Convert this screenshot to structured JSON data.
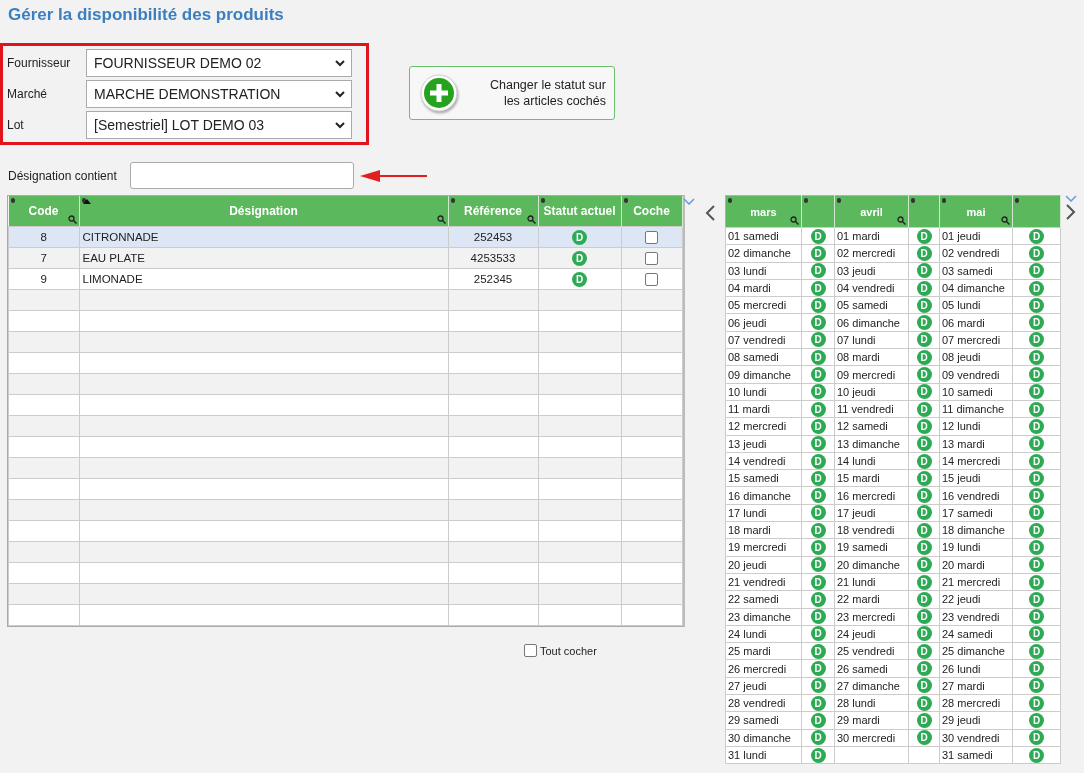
{
  "title": "Gérer la disponibilité des produits",
  "filters": [
    {
      "label": "Fournisseur",
      "value": "FOURNISSEUR DEMO 02"
    },
    {
      "label": "Marché",
      "value": "MARCHE DEMONSTRATION"
    },
    {
      "label": "Lot",
      "value": "[Semestriel] LOT DEMO 03"
    }
  ],
  "action_button": {
    "label": "Changer le statut sur les articles cochés"
  },
  "search": {
    "label": "Désignation contient"
  },
  "products": {
    "columns": [
      {
        "label": "Code",
        "filter": true,
        "sorted": false
      },
      {
        "label": "Désignation",
        "filter": true,
        "sorted": true
      },
      {
        "label": "Référence",
        "filter": true,
        "sorted": false
      },
      {
        "label": "Statut actuel",
        "filter": false,
        "sorted": false
      },
      {
        "label": "Coche",
        "filter": false,
        "sorted": false
      }
    ],
    "rows": [
      {
        "code": "8",
        "designation": "CITRONNADE",
        "reference": "252453",
        "status": "D",
        "checked": false,
        "selected": true
      },
      {
        "code": "7",
        "designation": "EAU PLATE",
        "reference": "4253533",
        "status": "D",
        "checked": false,
        "selected": false
      },
      {
        "code": "9",
        "designation": "LIMONADE",
        "reference": "252345",
        "status": "D",
        "checked": false,
        "selected": false
      }
    ]
  },
  "select_all": {
    "label": "Tout cocher",
    "checked": false
  },
  "calendar": {
    "months": [
      {
        "name": "mars",
        "days": [
          {
            "label": "01 samedi",
            "status": "D"
          },
          {
            "label": "02 dimanche",
            "status": "D"
          },
          {
            "label": "03 lundi",
            "status": "D"
          },
          {
            "label": "04 mardi",
            "status": "D"
          },
          {
            "label": "05 mercredi",
            "status": "D"
          },
          {
            "label": "06 jeudi",
            "status": "D"
          },
          {
            "label": "07 vendredi",
            "status": "D"
          },
          {
            "label": "08 samedi",
            "status": "D"
          },
          {
            "label": "09 dimanche",
            "status": "D"
          },
          {
            "label": "10 lundi",
            "status": "D"
          },
          {
            "label": "11 mardi",
            "status": "D"
          },
          {
            "label": "12 mercredi",
            "status": "D"
          },
          {
            "label": "13 jeudi",
            "status": "D"
          },
          {
            "label": "14 vendredi",
            "status": "D"
          },
          {
            "label": "15 samedi",
            "status": "D"
          },
          {
            "label": "16 dimanche",
            "status": "D"
          },
          {
            "label": "17 lundi",
            "status": "D"
          },
          {
            "label": "18 mardi",
            "status": "D"
          },
          {
            "label": "19 mercredi",
            "status": "D"
          },
          {
            "label": "20 jeudi",
            "status": "D"
          },
          {
            "label": "21 vendredi",
            "status": "D"
          },
          {
            "label": "22 samedi",
            "status": "D"
          },
          {
            "label": "23 dimanche",
            "status": "D"
          },
          {
            "label": "24 lundi",
            "status": "D"
          },
          {
            "label": "25 mardi",
            "status": "D"
          },
          {
            "label": "26 mercredi",
            "status": "D"
          },
          {
            "label": "27 jeudi",
            "status": "D"
          },
          {
            "label": "28 vendredi",
            "status": "D"
          },
          {
            "label": "29 samedi",
            "status": "D"
          },
          {
            "label": "30 dimanche",
            "status": "D"
          },
          {
            "label": "31 lundi",
            "status": "D"
          }
        ]
      },
      {
        "name": "avril",
        "days": [
          {
            "label": "01 mardi",
            "status": "D"
          },
          {
            "label": "02 mercredi",
            "status": "D"
          },
          {
            "label": "03 jeudi",
            "status": "D"
          },
          {
            "label": "04 vendredi",
            "status": "D"
          },
          {
            "label": "05 samedi",
            "status": "D"
          },
          {
            "label": "06 dimanche",
            "status": "D"
          },
          {
            "label": "07 lundi",
            "status": "D"
          },
          {
            "label": "08 mardi",
            "status": "D"
          },
          {
            "label": "09 mercredi",
            "status": "D"
          },
          {
            "label": "10 jeudi",
            "status": "D"
          },
          {
            "label": "11 vendredi",
            "status": "D"
          },
          {
            "label": "12 samedi",
            "status": "D"
          },
          {
            "label": "13 dimanche",
            "status": "D"
          },
          {
            "label": "14 lundi",
            "status": "D"
          },
          {
            "label": "15 mardi",
            "status": "D"
          },
          {
            "label": "16 mercredi",
            "status": "D"
          },
          {
            "label": "17 jeudi",
            "status": "D"
          },
          {
            "label": "18 vendredi",
            "status": "D"
          },
          {
            "label": "19 samedi",
            "status": "D"
          },
          {
            "label": "20 dimanche",
            "status": "D"
          },
          {
            "label": "21 lundi",
            "status": "D"
          },
          {
            "label": "22 mardi",
            "status": "D"
          },
          {
            "label": "23 mercredi",
            "status": "D"
          },
          {
            "label": "24 jeudi",
            "status": "D"
          },
          {
            "label": "25 vendredi",
            "status": "D"
          },
          {
            "label": "26 samedi",
            "status": "D"
          },
          {
            "label": "27 dimanche",
            "status": "D"
          },
          {
            "label": "28 lundi",
            "status": "D"
          },
          {
            "label": "29 mardi",
            "status": "D"
          },
          {
            "label": "30 mercredi",
            "status": "D"
          }
        ]
      },
      {
        "name": "mai",
        "days": [
          {
            "label": "01 jeudi",
            "status": "D"
          },
          {
            "label": "02 vendredi",
            "status": "D"
          },
          {
            "label": "03 samedi",
            "status": "D"
          },
          {
            "label": "04 dimanche",
            "status": "D"
          },
          {
            "label": "05 lundi",
            "status": "D"
          },
          {
            "label": "06 mardi",
            "status": "D"
          },
          {
            "label": "07 mercredi",
            "status": "D"
          },
          {
            "label": "08 jeudi",
            "status": "D"
          },
          {
            "label": "09 vendredi",
            "status": "D"
          },
          {
            "label": "10 samedi",
            "status": "D"
          },
          {
            "label": "11 dimanche",
            "status": "D"
          },
          {
            "label": "12 lundi",
            "status": "D"
          },
          {
            "label": "13 mardi",
            "status": "D"
          },
          {
            "label": "14 mercredi",
            "status": "D"
          },
          {
            "label": "15 jeudi",
            "status": "D"
          },
          {
            "label": "16 vendredi",
            "status": "D"
          },
          {
            "label": "17 samedi",
            "status": "D"
          },
          {
            "label": "18 dimanche",
            "status": "D"
          },
          {
            "label": "19 lundi",
            "status": "D"
          },
          {
            "label": "20 mardi",
            "status": "D"
          },
          {
            "label": "21 mercredi",
            "status": "D"
          },
          {
            "label": "22 jeudi",
            "status": "D"
          },
          {
            "label": "23 vendredi",
            "status": "D"
          },
          {
            "label": "24 samedi",
            "status": "D"
          },
          {
            "label": "25 dimanche",
            "status": "D"
          },
          {
            "label": "26 lundi",
            "status": "D"
          },
          {
            "label": "27 mardi",
            "status": "D"
          },
          {
            "label": "28 mercredi",
            "status": "D"
          },
          {
            "label": "29 jeudi",
            "status": "D"
          },
          {
            "label": "30 vendredi",
            "status": "D"
          },
          {
            "label": "31 samedi",
            "status": "D"
          }
        ]
      }
    ]
  }
}
